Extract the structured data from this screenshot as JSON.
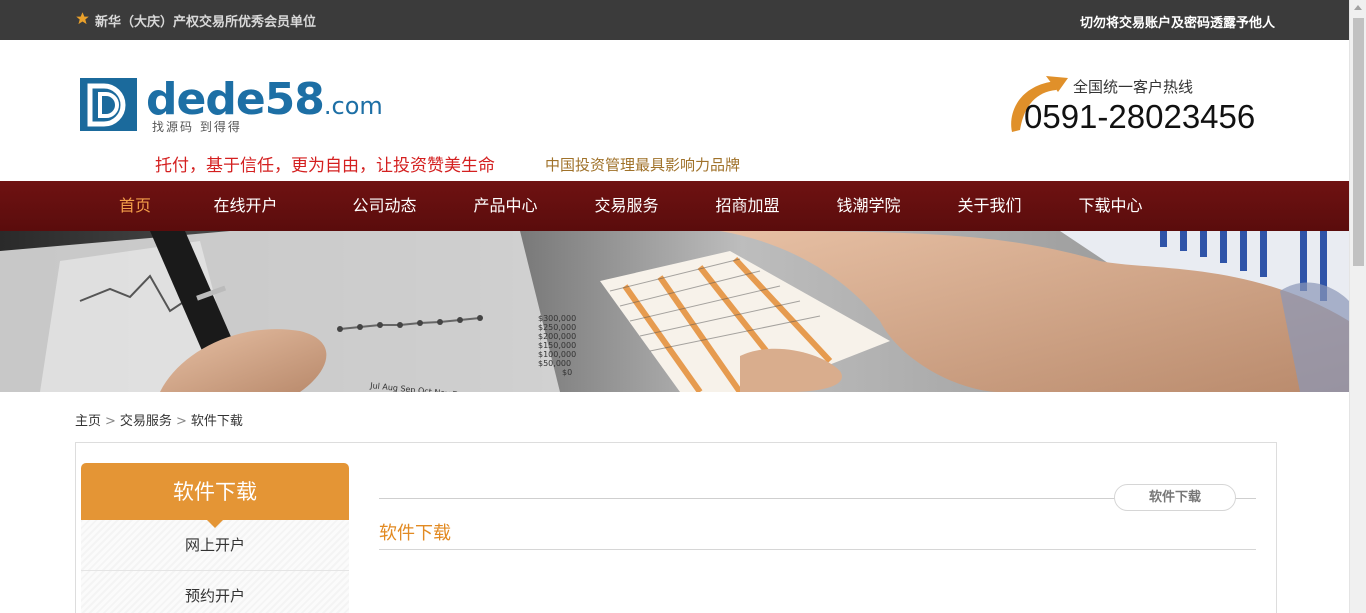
{
  "topbar": {
    "member_text": "新华（大庆）产权交易所优秀会员单位",
    "warning_text": "切勿将交易账户及密码透露予他人"
  },
  "header": {
    "logo_text": "dede58",
    "logo_domain": ".com",
    "logo_slogan": "找源码 到得得",
    "tagline_main": "托付，基于信任，更为自由，让投资赞美生命",
    "tagline_sub": "中国投资管理最具影响力品牌",
    "hotline_label": "全国统一客户热线",
    "hotline_number": "0591-28023456"
  },
  "nav": {
    "items": [
      "首页",
      "在线开户",
      "公司动态",
      "产品中心",
      "交易服务",
      "招商加盟",
      "钱潮学院",
      "关于我们",
      "下载中心"
    ],
    "active_index": 0
  },
  "banner": {
    "axis_values": [
      "$300,000",
      "$250,000",
      "$200,000",
      "$150,000",
      "$100,000",
      "$50,000",
      "$0"
    ],
    "months": "Jul Aug Sep Oct Nov Dec"
  },
  "breadcrumb": {
    "items": [
      "主页",
      "交易服务",
      "软件下载"
    ],
    "separator": ">"
  },
  "sidebar": {
    "title": "软件下载",
    "items": [
      "网上开户",
      "预约开户"
    ]
  },
  "main": {
    "pill": "软件下载",
    "title": "软件下载"
  },
  "colors": {
    "topbar": "#3b3b3b",
    "nav": "#651010",
    "nav_active": "#f39e4a",
    "accent": "#e49535",
    "tagline_red": "#d42020",
    "brand_blue": "#1d6fa5"
  }
}
